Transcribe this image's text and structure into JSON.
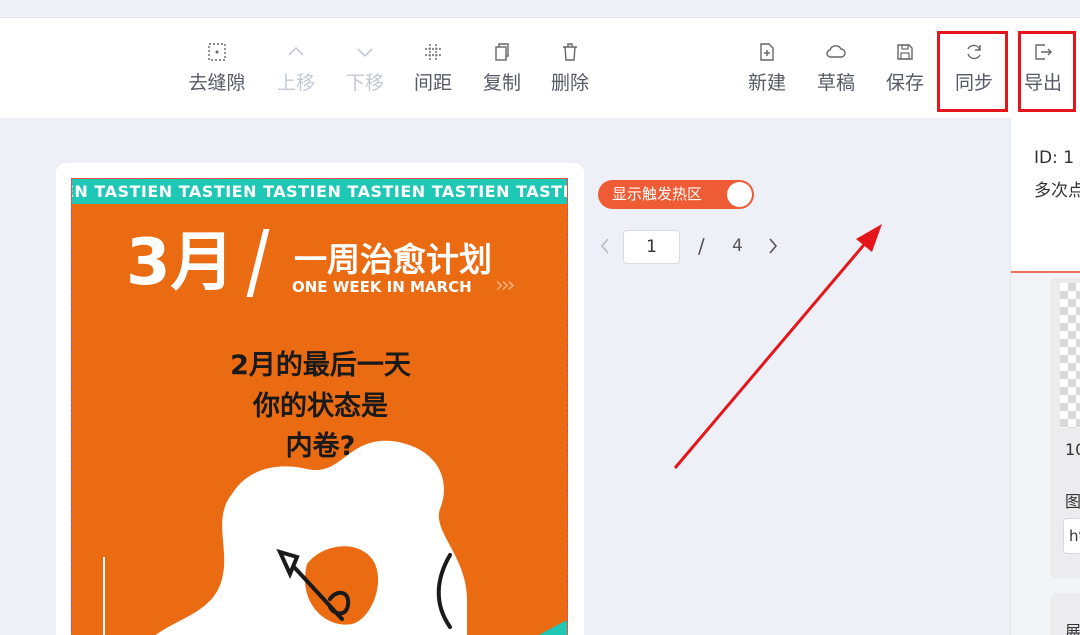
{
  "toolbar": {
    "tools_left": [
      {
        "icon": "grid-icon",
        "label": "去缝隙",
        "disabled": false
      },
      {
        "icon": "chevron-up-icon",
        "label": "上移",
        "disabled": true
      },
      {
        "icon": "chevron-down-icon",
        "label": "下移",
        "disabled": true
      },
      {
        "icon": "spacing-icon",
        "label": "间距",
        "disabled": false
      },
      {
        "icon": "copy-icon",
        "label": "复制",
        "disabled": false
      },
      {
        "icon": "trash-icon",
        "label": "删除",
        "disabled": false
      }
    ],
    "tools_right": [
      {
        "icon": "new-file-icon",
        "label": "新建"
      },
      {
        "icon": "cloud-icon",
        "label": "草稿"
      },
      {
        "icon": "save-icon",
        "label": "保存"
      },
      {
        "icon": "sync-icon",
        "label": "同步",
        "highlighted": true
      },
      {
        "icon": "export-icon",
        "label": "导出",
        "highlighted": true
      }
    ]
  },
  "hotzone_toggle": {
    "label": "显示触发热区",
    "on": true
  },
  "pagination": {
    "current": "1",
    "separator": "/",
    "total": "4"
  },
  "poster": {
    "band_text": "EN TASTIEN TASTIEN TASTIEN TASTIEN TASTIEN TASTIEN TASTIEN",
    "big": "3月",
    "title": "一周治愈计划",
    "subtitle": "ONE WEEK IN MARCH",
    "arrows": "›››",
    "lines": [
      "2月的最后一天",
      "你的状态是",
      "内卷?"
    ]
  },
  "right_panel": {
    "id_text": "ID: 1",
    "multi_text": "多次点",
    "num_text": "10",
    "label_text": "图",
    "input_text": "ht",
    "label2_text": "展"
  },
  "colors": {
    "accent": "#ef5b35",
    "highlight": "#e5161b",
    "poster_bg": "#ea6b12",
    "poster_band": "#1ec8b4",
    "canvas_bg": "#edf0f7"
  }
}
